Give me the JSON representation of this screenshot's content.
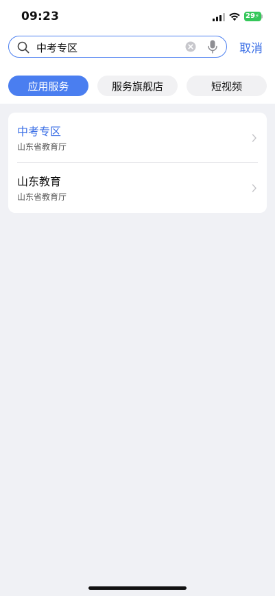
{
  "status_bar": {
    "time": "09:23",
    "battery": "29"
  },
  "search": {
    "query": "中考专区",
    "cancel_label": "取消"
  },
  "tabs": [
    {
      "label": "应用服务",
      "active": true
    },
    {
      "label": "服务旗舰店",
      "active": false
    },
    {
      "label": "短视频",
      "active": false
    }
  ],
  "results": [
    {
      "title": "中考专区",
      "subtitle": "山东省教育厅"
    },
    {
      "title": "山东教育",
      "subtitle": "山东省教育厅"
    }
  ],
  "colors": {
    "accent": "#4a7ef0",
    "link": "#3b6fe6",
    "battery": "#34c759",
    "background": "#f0f1f5"
  }
}
